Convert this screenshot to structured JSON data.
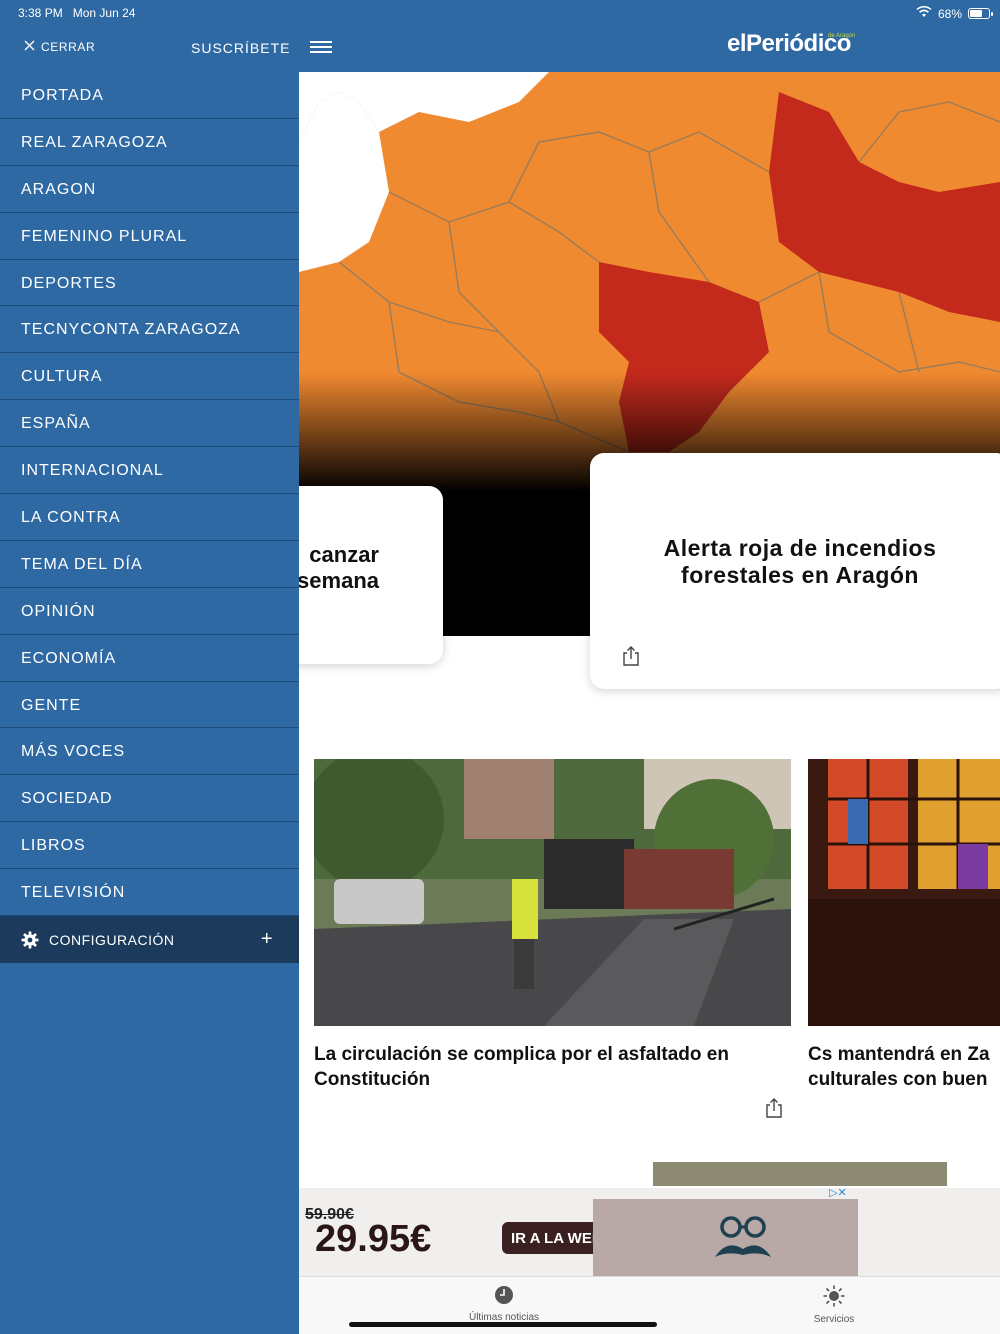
{
  "status_bar": {
    "time": "3:38 PM",
    "date": "Mon Jun 24",
    "battery": "68%",
    "battery_level": 0.68
  },
  "header": {
    "close_label": "CERRAR",
    "subscribe_label": "SUSCRÍBETE",
    "logo_text": "elPeriódico",
    "logo_sub": "de Aragón"
  },
  "menu": {
    "items": [
      "PORTADA",
      "REAL ZARAGOZA",
      "ARAGON",
      "FEMENINO PLURAL",
      "DEPORTES",
      "TECNYCONTA ZARAGOZA",
      "CULTURA",
      "ESPAÑA",
      "INTERNACIONAL",
      "LA CONTRA",
      "TEMA DEL DÍA",
      "OPINIÓN",
      "ECONOMÍA",
      "GENTE",
      "MÁS VOCES",
      "SOCIEDAD",
      "LIBROS",
      "TELEVISIÓN"
    ],
    "config_label": "CONFIGURACIÓN"
  },
  "cards": {
    "left_title_line1": "canzar",
    "left_title_line2": "semana",
    "right_title": "Alerta roja de incendios forestales en Aragón"
  },
  "articles": [
    {
      "title": "La circulación se complica por el asfaltado en Constitución"
    },
    {
      "title_line1": "Cs mantendrá en Za",
      "title_line2": "culturales con buen"
    }
  ],
  "ad": {
    "old_price": "59.90€",
    "new_price": "29.95€",
    "cta": "IR A LA WEB"
  },
  "tabbar": {
    "tab1": "Últimas noticias",
    "tab2": "Servicios"
  },
  "colors": {
    "brand_blue": "#2e69a3",
    "config_bg": "#1c3a5c",
    "map_orange": "#f08a30",
    "map_red": "#c42a1c"
  }
}
